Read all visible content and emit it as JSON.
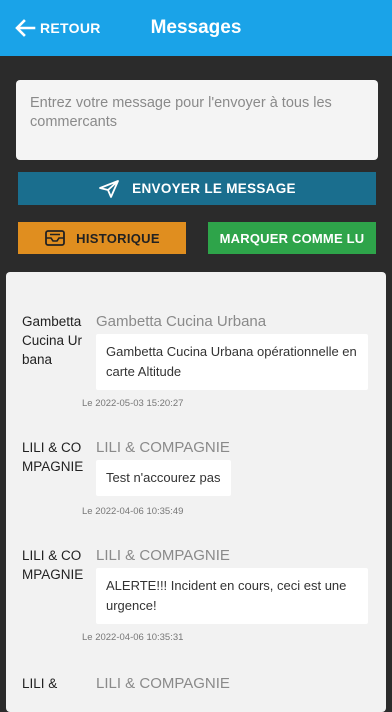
{
  "header": {
    "back_label": "RETOUR",
    "title": "Messages"
  },
  "compose": {
    "placeholder": "Entrez votre message pour l'envoyer à tous les commercants",
    "send_label": "ENVOYER LE MESSAGE"
  },
  "actions": {
    "history_label": "HISTORIQUE",
    "mark_read_label": "MARQUER COMME LU"
  },
  "messages": [
    {
      "sender": "Gambetta Cucina Urbana",
      "company": "Gambetta Cucina Urbana",
      "text": "Gambetta Cucina Urbana opérationnelle en carte Altitude",
      "time": "Le 2022-05-03 15:20:27"
    },
    {
      "sender": "LILI & COMPAGNIE",
      "company": "LILI & COMPAGNIE",
      "text": "Test n'accourez pas",
      "time": "Le 2022-04-06 10:35:49"
    },
    {
      "sender": "LILI & COMPAGNIE",
      "company": "LILI & COMPAGNIE",
      "text": "ALERTE!!! Incident en cours, ceci est une urgence!",
      "time": "Le 2022-04-06 10:35:31"
    },
    {
      "sender": "LILI &",
      "company": "LILI & COMPAGNIE",
      "text": "",
      "time": ""
    }
  ]
}
